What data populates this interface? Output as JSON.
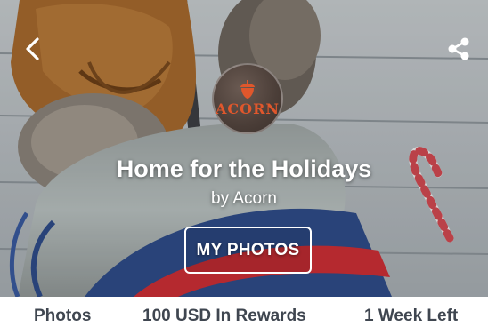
{
  "hero": {
    "brand_logo_text": "ACORN",
    "title": "Home for the Holidays",
    "byline": "by Acorn",
    "button_label": "MY PHOTOS"
  },
  "stats": {
    "photos": "Photos",
    "rewards": "100 USD In Rewards",
    "time_left": "1 Week Left"
  },
  "icons": {
    "back": "chevron-left-icon",
    "share": "share-icon",
    "logo": "acorn-icon"
  },
  "colors": {
    "logo_accent": "#e0572c",
    "stat_text": "#3f4650",
    "overlay_text": "#ffffff"
  }
}
